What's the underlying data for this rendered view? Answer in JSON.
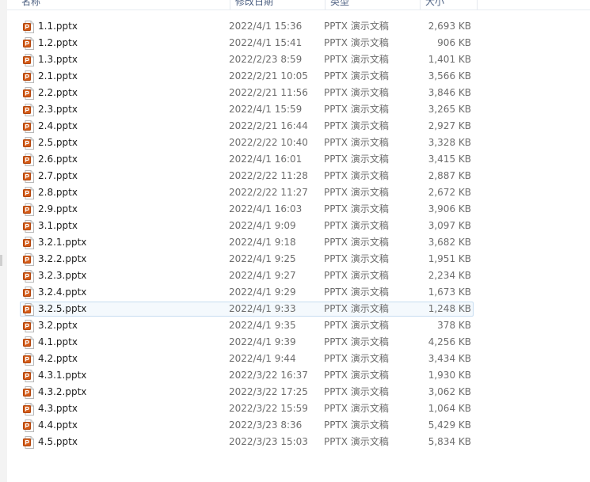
{
  "header": {
    "name": "名称",
    "date": "修改日期",
    "type": "类型",
    "size": "大小"
  },
  "icon": "pptx-file-icon",
  "accent": "#d35b18",
  "files": [
    {
      "name": "1.1.pptx",
      "date": "2022/4/1 15:36",
      "type": "PPTX 演示文稿",
      "size": "2,693 KB"
    },
    {
      "name": "1.2.pptx",
      "date": "2022/4/1 15:41",
      "type": "PPTX 演示文稿",
      "size": "906 KB"
    },
    {
      "name": "1.3.pptx",
      "date": "2022/2/23 8:59",
      "type": "PPTX 演示文稿",
      "size": "1,401 KB"
    },
    {
      "name": "2.1.pptx",
      "date": "2022/2/21 10:05",
      "type": "PPTX 演示文稿",
      "size": "3,566 KB"
    },
    {
      "name": "2.2.pptx",
      "date": "2022/2/21 11:56",
      "type": "PPTX 演示文稿",
      "size": "3,846 KB"
    },
    {
      "name": "2.3.pptx",
      "date": "2022/4/1 15:59",
      "type": "PPTX 演示文稿",
      "size": "3,265 KB"
    },
    {
      "name": "2.4.pptx",
      "date": "2022/2/21 16:44",
      "type": "PPTX 演示文稿",
      "size": "2,927 KB"
    },
    {
      "name": "2.5.pptx",
      "date": "2022/2/22 10:40",
      "type": "PPTX 演示文稿",
      "size": "3,328 KB"
    },
    {
      "name": "2.6.pptx",
      "date": "2022/4/1 16:01",
      "type": "PPTX 演示文稿",
      "size": "3,415 KB"
    },
    {
      "name": "2.7.pptx",
      "date": "2022/2/22 11:28",
      "type": "PPTX 演示文稿",
      "size": "2,887 KB"
    },
    {
      "name": "2.8.pptx",
      "date": "2022/2/22 11:27",
      "type": "PPTX 演示文稿",
      "size": "2,672 KB"
    },
    {
      "name": "2.9.pptx",
      "date": "2022/4/1 16:03",
      "type": "PPTX 演示文稿",
      "size": "3,906 KB"
    },
    {
      "name": "3.1.pptx",
      "date": "2022/4/1 9:09",
      "type": "PPTX 演示文稿",
      "size": "3,097 KB"
    },
    {
      "name": "3.2.1.pptx",
      "date": "2022/4/1 9:18",
      "type": "PPTX 演示文稿",
      "size": "3,682 KB"
    },
    {
      "name": "3.2.2.pptx",
      "date": "2022/4/1 9:25",
      "type": "PPTX 演示文稿",
      "size": "1,951 KB"
    },
    {
      "name": "3.2.3.pptx",
      "date": "2022/4/1 9:27",
      "type": "PPTX 演示文稿",
      "size": "2,234 KB"
    },
    {
      "name": "3.2.4.pptx",
      "date": "2022/4/1 9:29",
      "type": "PPTX 演示文稿",
      "size": "1,673 KB"
    },
    {
      "name": "3.2.5.pptx",
      "date": "2022/4/1 9:33",
      "type": "PPTX 演示文稿",
      "size": "1,248 KB",
      "selected": true
    },
    {
      "name": "3.2.pptx",
      "date": "2022/4/1 9:35",
      "type": "PPTX 演示文稿",
      "size": "378 KB"
    },
    {
      "name": "4.1.pptx",
      "date": "2022/4/1 9:39",
      "type": "PPTX 演示文稿",
      "size": "4,256 KB"
    },
    {
      "name": "4.2.pptx",
      "date": "2022/4/1 9:44",
      "type": "PPTX 演示文稿",
      "size": "3,434 KB"
    },
    {
      "name": "4.3.1.pptx",
      "date": "2022/3/22 16:37",
      "type": "PPTX 演示文稿",
      "size": "1,930 KB"
    },
    {
      "name": "4.3.2.pptx",
      "date": "2022/3/22 17:25",
      "type": "PPTX 演示文稿",
      "size": "3,062 KB"
    },
    {
      "name": "4.3.pptx",
      "date": "2022/3/22 15:59",
      "type": "PPTX 演示文稿",
      "size": "1,064 KB"
    },
    {
      "name": "4.4.pptx",
      "date": "2022/3/23 8:36",
      "type": "PPTX 演示文稿",
      "size": "5,429 KB"
    },
    {
      "name": "4.5.pptx",
      "date": "2022/3/23 15:03",
      "type": "PPTX 演示文稿",
      "size": "5,834 KB"
    }
  ]
}
